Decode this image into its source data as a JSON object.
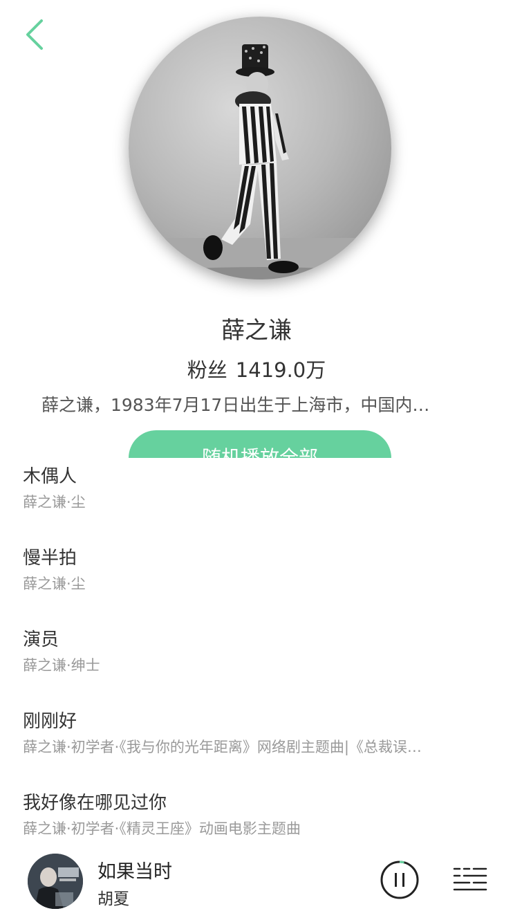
{
  "header": {
    "back_icon": "chevron-left-icon",
    "accent_color": "#66d19e"
  },
  "artist": {
    "name": "薛之谦",
    "fans_label": "粉丝",
    "fans_count": "1419.0万",
    "bio": "薛之谦，1983年7月17日出生于上海市，中国内…"
  },
  "play_all": {
    "label": "随机播放全部"
  },
  "songs": [
    {
      "title": "木偶人",
      "subtitle": "薛之谦·尘"
    },
    {
      "title": "慢半拍",
      "subtitle": "薛之谦·尘"
    },
    {
      "title": "演员",
      "subtitle": "薛之谦·绅士"
    },
    {
      "title": "刚刚好",
      "subtitle": "薛之谦·初学者·《我与你的光年距离》网络剧主题曲|《总裁误…"
    },
    {
      "title": "我好像在哪见过你",
      "subtitle": "薛之谦·初学者·《精灵王座》动画电影主题曲"
    }
  ],
  "now_playing": {
    "title": "如果当时",
    "artist": "胡夏",
    "progress": 0.04,
    "pause_icon": "pause-icon",
    "playlist_icon": "playlist-icon"
  }
}
